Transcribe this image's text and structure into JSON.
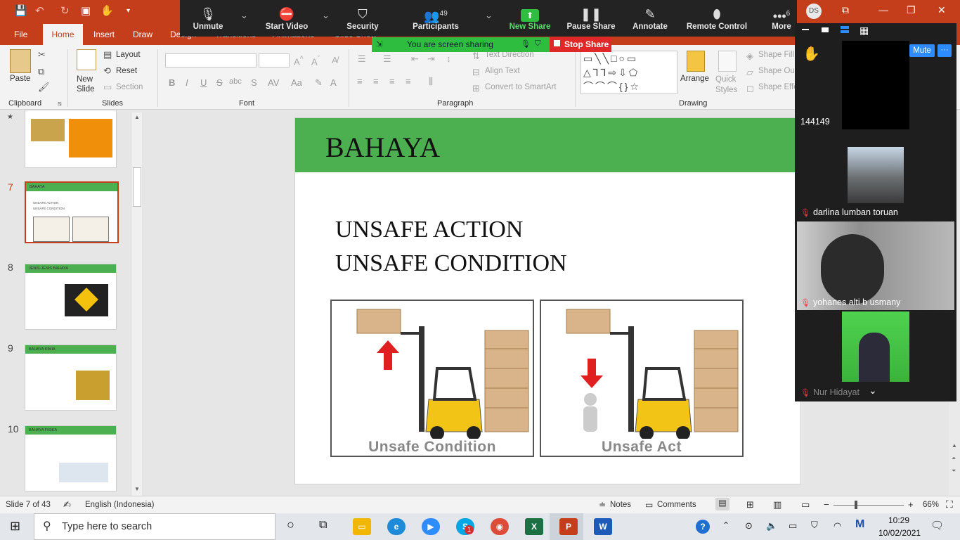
{
  "ribbon_tabs": [
    "File",
    "Home",
    "Insert",
    "Draw",
    "Design",
    "Transitions",
    "Animations",
    "Slide Show"
  ],
  "ribbon": {
    "paste": "Paste",
    "new_slide": "New\nSlide",
    "layout": "Layout",
    "reset": "Reset",
    "section": "Section",
    "text_direction": "Text Direction",
    "align_text": "Align Text",
    "convert_smartart": "Convert to SmartArt",
    "arrange": "Arrange",
    "quick_styles": "Quick\nStyles",
    "shape_fill": "Shape Fill",
    "shape_outline": "Shape Out",
    "shape_effects": "Shape Effe",
    "groups": [
      "Clipboard",
      "Slides",
      "Font",
      "Paragraph",
      "Drawing"
    ]
  },
  "user_initials": "DS",
  "zoom": {
    "buttons": [
      {
        "label": "Unmute",
        "icon": "🎤"
      },
      {
        "label": "Start Video",
        "icon": "📹"
      },
      {
        "label": "Security",
        "icon": "🛡"
      },
      {
        "label": "Participants",
        "icon": "👥",
        "count": "49"
      },
      {
        "label": "New Share",
        "icon": "⬆"
      },
      {
        "label": "Pause Share",
        "icon": "❚❚"
      },
      {
        "label": "Annotate",
        "icon": "✎"
      },
      {
        "label": "Remote Control",
        "icon": "🖱"
      },
      {
        "label": "More",
        "icon": "•••",
        "count": "6"
      }
    ],
    "sharing_text": "You are screen sharing",
    "stop_share": "Stop Share",
    "mute_button": "Mute",
    "more_button": "···",
    "participants": [
      {
        "name": "144149"
      },
      {
        "name": "darlina lumban toruan"
      },
      {
        "name": "yohanes alti b usmany"
      },
      {
        "name": "Nur Hidayat"
      }
    ]
  },
  "thumbnails": [
    {
      "num": "",
      "title": ""
    },
    {
      "num": "7",
      "title": "BAHAYA",
      "lines": [
        "UNSAFE ACTION",
        "UNSAFE CONDITION"
      ]
    },
    {
      "num": "8",
      "title": "JENIS-JENIS BAHAYA"
    },
    {
      "num": "9",
      "title": "BAHAYA KIMIA"
    },
    {
      "num": "10",
      "title": "BAHAYA FISIKA"
    }
  ],
  "slide": {
    "title": "BAHAYA",
    "line1": "UNSAFE ACTION",
    "line2": "UNSAFE CONDITION",
    "image_left_label": "Unsafe Condition",
    "image_right_label": "Unsafe Act"
  },
  "status": {
    "slide_counter": "Slide 7 of 43",
    "language": "English (Indonesia)",
    "notes": "Notes",
    "comments": "Comments",
    "zoom": "66%"
  },
  "taskbar": {
    "search_placeholder": "Type here to search",
    "time": "10:29",
    "date": "10/02/2021",
    "skype_badge": "1"
  },
  "colors": {
    "ppt_accent": "#c43e1c",
    "slide_green": "#4caf50",
    "zoom_share_green": "#2fbd3f",
    "stop_red": "#e02828"
  }
}
